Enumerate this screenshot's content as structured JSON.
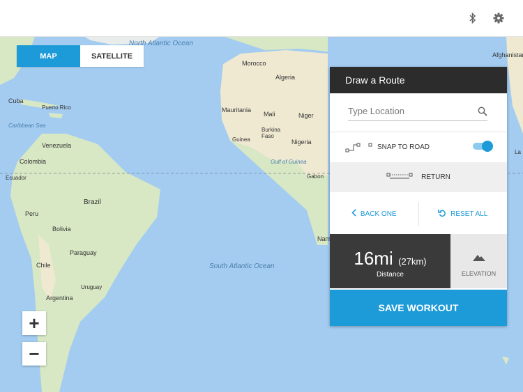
{
  "topbar": {
    "icons": [
      "bluetooth-icon",
      "gear-icon"
    ]
  },
  "map_toggle": {
    "map_label": "MAP",
    "satellite_label": "SATELLITE"
  },
  "map_labels": {
    "north_atlantic": "North Atlantic Ocean",
    "south_atlantic": "South Atlantic Ocean",
    "caribbean": "Caribbean Sea",
    "gulf_guinea": "Gulf of Guinea",
    "morocco": "Morocco",
    "algeria": "Algeria",
    "mauritania": "Mauritania",
    "mali": "Mali",
    "niger": "Niger",
    "burkina": "Burkina Faso",
    "guinea": "Guinea",
    "nigeria": "Nigeria",
    "gabon": "Gabon",
    "namibia_partial": "Nam",
    "afghanistan": "Afghanistan",
    "cuba": "Cuba",
    "puerto_rico": "Puerto Rico",
    "venezuela": "Venezuela",
    "colombia": "Colombia",
    "ecuador": "Ecuador",
    "peru": "Peru",
    "brazil": "Brazil",
    "bolivia": "Bolivia",
    "paraguay": "Paraguay",
    "chile": "Chile",
    "uruguay": "Uruguay",
    "argentina": "Argentina",
    "edge_la": "La"
  },
  "zoom": {
    "in_label": "+",
    "out_label": "−"
  },
  "panel": {
    "title": "Draw a Route",
    "search_placeholder": "Type Location",
    "snap_label": "SNAP TO ROAD",
    "snap_on": true,
    "return_label": "RETURN",
    "back_label": "BACK ONE",
    "reset_label": "RESET ALL",
    "distance_value": "16mi",
    "distance_km": "(27km)",
    "distance_label": "Distance",
    "elevation_label": "ELEVATION",
    "save_label": "SAVE WORKOUT"
  },
  "colors": {
    "accent": "#1d9ad8",
    "water": "#a3ccf0",
    "land": "#d8e8c4",
    "desert": "#efe9d2"
  }
}
